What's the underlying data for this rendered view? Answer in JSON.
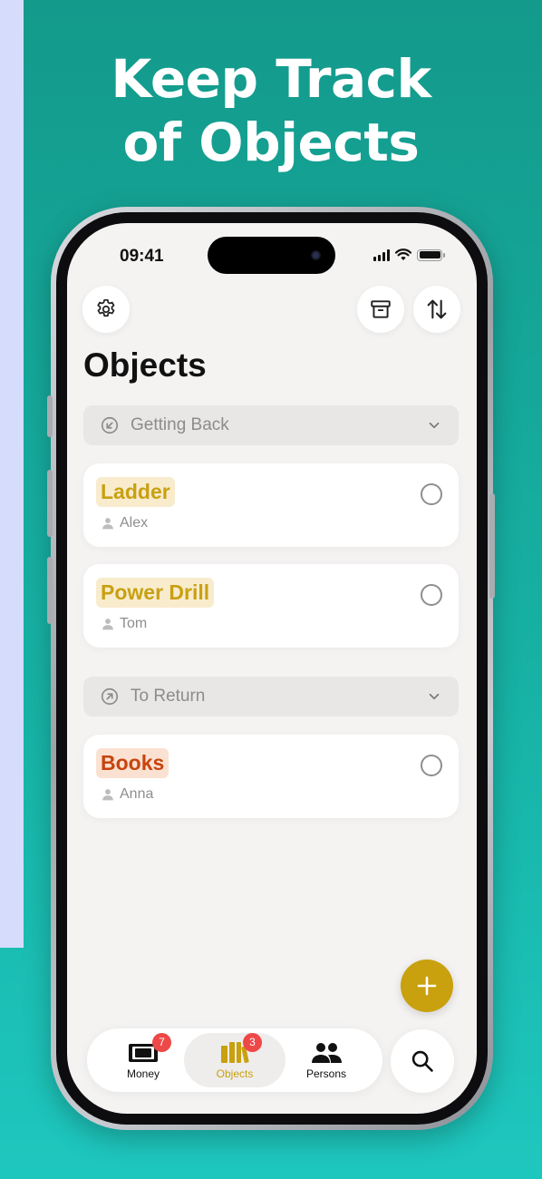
{
  "headline": {
    "line1": "Keep Track",
    "line2": "of Objects"
  },
  "status_bar": {
    "time": "09:41"
  },
  "header": {
    "title": "Objects",
    "settings_icon": "gear-icon",
    "archive_icon": "archive-box-icon",
    "sort_icon": "sort-arrows-icon"
  },
  "sections": [
    {
      "label": "Getting Back",
      "icon": "arrow-down-left-circle-icon",
      "items": [
        {
          "name": "Ladder",
          "person": "Alex",
          "color": "#c9a012",
          "tint": "#f8eccd"
        },
        {
          "name": "Power Drill",
          "person": "Tom",
          "color": "#c9a012",
          "tint": "#f8eccd"
        }
      ]
    },
    {
      "label": "To Return",
      "icon": "arrow-up-right-circle-icon",
      "items": [
        {
          "name": "Books",
          "person": "Anna",
          "color": "#c7440d",
          "tint": "#fbe1d2"
        }
      ]
    }
  ],
  "tabbar": {
    "tabs": [
      {
        "label": "Money",
        "badge": "7",
        "icon": "banknote-icon"
      },
      {
        "label": "Objects",
        "badge": "3",
        "icon": "books-icon",
        "active": true
      },
      {
        "label": "Persons",
        "icon": "two-persons-icon"
      }
    ]
  },
  "colors": {
    "accent": "#c9a00e",
    "badge": "#ee4848",
    "background_teal": "#17b3a6"
  }
}
